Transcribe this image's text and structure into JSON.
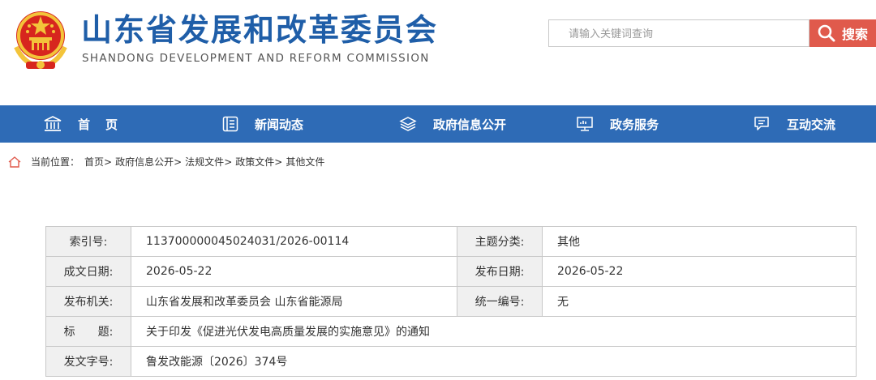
{
  "header": {
    "title_cn": "山东省发展和改革委员会",
    "title_en": "SHANDONG DEVELOPMENT AND REFORM COMMISSION",
    "emblem_icon": "national-emblem-icon",
    "search": {
      "placeholder": "请输入关键词查询",
      "button_label": "搜索"
    }
  },
  "nav": {
    "items": [
      {
        "label": "首　页",
        "icon": "bank-icon"
      },
      {
        "label": "新闻动态",
        "icon": "news-list-icon"
      },
      {
        "label": "政府信息公开",
        "icon": "layers-icon"
      },
      {
        "label": "政务服务",
        "icon": "monitor-icon"
      },
      {
        "label": "互动交流",
        "icon": "chat-icon"
      }
    ]
  },
  "breadcrumb": {
    "prefix": "当前位置：",
    "items": [
      "首页",
      "政府信息公开",
      "法规文件",
      "政策文件",
      "其他文件"
    ],
    "separator": ">"
  },
  "info": {
    "index_label": "索引号:",
    "index_value": "113700000045024031/2026-00114",
    "topic_label": "主题分类:",
    "topic_value": "其他",
    "created_label": "成文日期:",
    "created_value": "2026-05-22",
    "published_label": "发布日期:",
    "published_value": "2026-05-22",
    "issuer_label": "发布机关:",
    "issuer_value": "山东省发展和改革委员会 山东省能源局",
    "serial_label": "统一编号:",
    "serial_value": "无",
    "title_label": "标　　题:",
    "title_value": "关于印发《促进光伏发电高质量发展的实施意见》的通知",
    "docno_label": "发文字号:",
    "docno_value": "鲁发改能源〔2026〕374号"
  },
  "colors": {
    "brand_blue": "#2e6bb6",
    "title_blue": "#1f5ea8",
    "search_red": "#e05a4c"
  }
}
